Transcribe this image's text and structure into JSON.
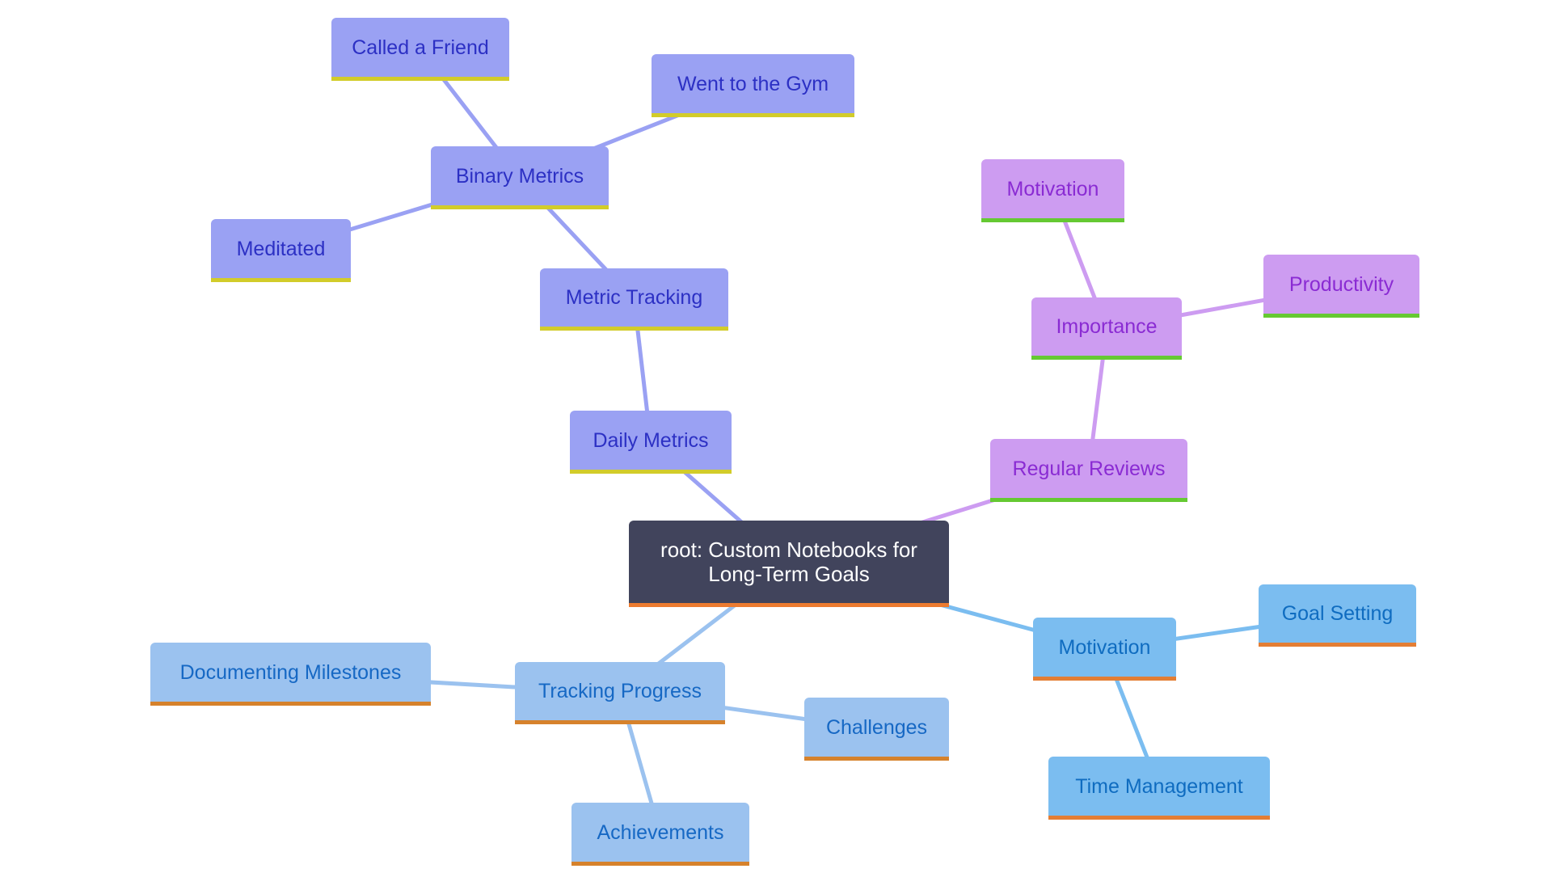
{
  "diagram": {
    "type": "mindmap",
    "root": {
      "id": "root",
      "label": "root: Custom Notebooks for Long-Term Goals",
      "label_lines": [
        "root: Custom Notebooks for",
        "Long-Term Goals"
      ]
    },
    "colors": {
      "indigo_fill": "#9aa1f3",
      "indigo_text": "#2c30c4",
      "indigo_accent": "#d2cc2a",
      "indigo_edge": "#9aa1f3",
      "purple_fill": "#cd9cf1",
      "purple_text": "#8a2bd3",
      "purple_accent": "#65c932",
      "purple_edge": "#cd9cf1",
      "sky_fill": "#7bbdf0",
      "sky_text": "#0f6cc0",
      "sky_accent": "#e47e34",
      "sky_edge": "#7bbdf0",
      "pale_fill": "#9bc2ef",
      "pale_text": "#1668c4",
      "pale_accent": "#d6822c",
      "pale_edge": "#9bc2ef",
      "root_fill": "#41445c",
      "root_text": "#ffffff",
      "root_accent": "#ec7b30"
    },
    "nodes": {
      "daily_metrics": {
        "label": "Daily Metrics",
        "parent": "root",
        "branch": "indigo"
      },
      "metric_tracking": {
        "label": "Metric Tracking",
        "parent": "daily_metrics",
        "branch": "indigo"
      },
      "binary_metrics": {
        "label": "Binary Metrics",
        "parent": "metric_tracking",
        "branch": "indigo"
      },
      "called_a_friend": {
        "label": "Called a Friend",
        "parent": "binary_metrics",
        "branch": "indigo"
      },
      "went_to_the_gym": {
        "label": "Went to the Gym",
        "parent": "binary_metrics",
        "branch": "indigo"
      },
      "meditated": {
        "label": "Meditated",
        "parent": "binary_metrics",
        "branch": "indigo"
      },
      "regular_reviews": {
        "label": "Regular Reviews",
        "parent": "root",
        "branch": "purple"
      },
      "importance": {
        "label": "Importance",
        "parent": "regular_reviews",
        "branch": "purple"
      },
      "motivation_importance": {
        "label": "Motivation",
        "parent": "importance",
        "branch": "purple"
      },
      "productivity": {
        "label": "Productivity",
        "parent": "importance",
        "branch": "purple"
      },
      "motivation": {
        "label": "Motivation",
        "parent": "root",
        "branch": "sky"
      },
      "goal_setting": {
        "label": "Goal Setting",
        "parent": "motivation",
        "branch": "sky"
      },
      "time_management": {
        "label": "Time Management",
        "parent": "motivation",
        "branch": "sky"
      },
      "tracking_progress": {
        "label": "Tracking Progress",
        "parent": "root",
        "branch": "pale"
      },
      "documenting_milestones": {
        "label": "Documenting Milestones",
        "parent": "tracking_progress",
        "branch": "pale"
      },
      "challenges": {
        "label": "Challenges",
        "parent": "tracking_progress",
        "branch": "pale"
      },
      "achievements": {
        "label": "Achievements",
        "parent": "tracking_progress",
        "branch": "pale"
      }
    }
  }
}
